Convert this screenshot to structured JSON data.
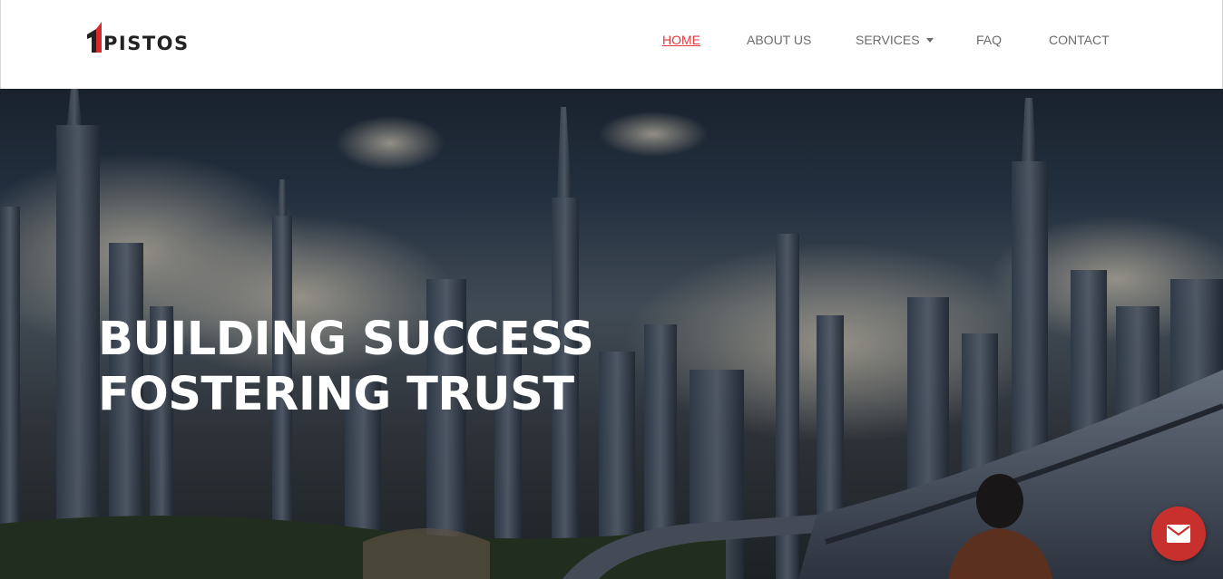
{
  "header": {
    "logo_text": "PISTOS",
    "nav": [
      {
        "label": "HOME",
        "active": true
      },
      {
        "label": "ABOUT US",
        "active": false
      },
      {
        "label": "SERVICES",
        "active": false,
        "has_dropdown": true
      },
      {
        "label": "FAQ",
        "active": false
      },
      {
        "label": "CONTACT",
        "active": false
      }
    ]
  },
  "hero": {
    "title_line1": "BUILDING SUCCESS",
    "title_line2": "FOSTERING TRUST"
  },
  "fab": {
    "icon": "envelope-icon"
  },
  "colors": {
    "accent": "#e2393d",
    "nav_text": "#6b6b6b",
    "fab": "#c8302e"
  }
}
